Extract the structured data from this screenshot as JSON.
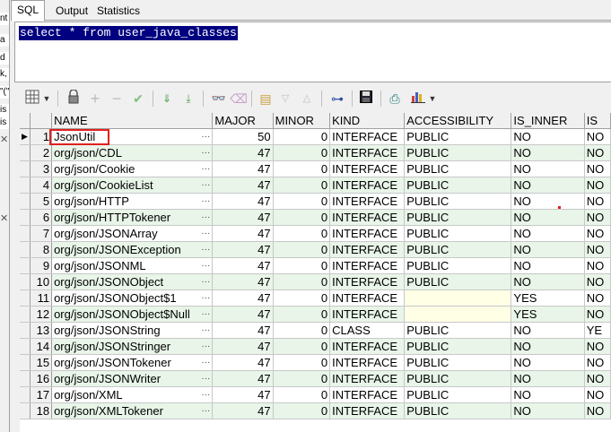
{
  "left_strip": {
    "fragments": [
      "nt",
      "a",
      "d",
      "k,",
      "\"(\"",
      "is",
      "is"
    ]
  },
  "tabs": [
    {
      "label": "SQL",
      "active": true
    },
    {
      "label": "Output",
      "active": false
    },
    {
      "label": "Statistics",
      "active": false
    }
  ],
  "editor": {
    "sql": "select * from user_java_classes"
  },
  "toolbar": {
    "icons": [
      "grid-options-icon",
      "dropdown-icon",
      "lock-icon",
      "add-record-icon",
      "delete-record-icon",
      "post-record-icon",
      "fetch-next-icon",
      "fetch-last-icon",
      "query-by-example-icon",
      "clear-icon",
      "export-icon",
      "sort-ascending-icon",
      "sort-descending-icon",
      "record-view-icon",
      "save-icon",
      "print-icon",
      "chart-icon"
    ]
  },
  "grid": {
    "columns": [
      "NAME",
      "MAJOR",
      "MINOR",
      "KIND",
      "ACCESSIBILITY",
      "IS_INNER",
      "IS"
    ],
    "rows": [
      [
        "1",
        "JsonUtil",
        "50",
        "0",
        "INTERFACE",
        "PUBLIC",
        "NO",
        "NO"
      ],
      [
        "2",
        "org/json/CDL",
        "47",
        "0",
        "INTERFACE",
        "PUBLIC",
        "NO",
        "NO"
      ],
      [
        "3",
        "org/json/Cookie",
        "47",
        "0",
        "INTERFACE",
        "PUBLIC",
        "NO",
        "NO"
      ],
      [
        "4",
        "org/json/CookieList",
        "47",
        "0",
        "INTERFACE",
        "PUBLIC",
        "NO",
        "NO"
      ],
      [
        "5",
        "org/json/HTTP",
        "47",
        "0",
        "INTERFACE",
        "PUBLIC",
        "NO",
        "NO"
      ],
      [
        "6",
        "org/json/HTTPTokener",
        "47",
        "0",
        "INTERFACE",
        "PUBLIC",
        "NO",
        "NO"
      ],
      [
        "7",
        "org/json/JSONArray",
        "47",
        "0",
        "INTERFACE",
        "PUBLIC",
        "NO",
        "NO"
      ],
      [
        "8",
        "org/json/JSONException",
        "47",
        "0",
        "INTERFACE",
        "PUBLIC",
        "NO",
        "NO"
      ],
      [
        "9",
        "org/json/JSONML",
        "47",
        "0",
        "INTERFACE",
        "PUBLIC",
        "NO",
        "NO"
      ],
      [
        "10",
        "org/json/JSONObject",
        "47",
        "0",
        "INTERFACE",
        "PUBLIC",
        "NO",
        "NO"
      ],
      [
        "11",
        "org/json/JSONObject$1",
        "47",
        "0",
        "INTERFACE",
        "",
        "YES",
        "NO"
      ],
      [
        "12",
        "org/json/JSONObject$Null",
        "47",
        "0",
        "INTERFACE",
        "",
        "YES",
        "NO"
      ],
      [
        "13",
        "org/json/JSONString",
        "47",
        "0",
        "CLASS",
        "PUBLIC",
        "NO",
        "YE"
      ],
      [
        "14",
        "org/json/JSONStringer",
        "47",
        "0",
        "INTERFACE",
        "PUBLIC",
        "NO",
        "NO"
      ],
      [
        "15",
        "org/json/JSONTokener",
        "47",
        "0",
        "INTERFACE",
        "PUBLIC",
        "NO",
        "NO"
      ],
      [
        "16",
        "org/json/JSONWriter",
        "47",
        "0",
        "INTERFACE",
        "PUBLIC",
        "NO",
        "NO"
      ],
      [
        "17",
        "org/json/XML",
        "47",
        "0",
        "INTERFACE",
        "PUBLIC",
        "NO",
        "NO"
      ],
      [
        "18",
        "org/json/XMLTokener",
        "47",
        "0",
        "INTERFACE",
        "PUBLIC",
        "NO",
        "NO"
      ]
    ],
    "current_row_indicator": "▶",
    "cell_ellipsis": "···"
  },
  "colors": {
    "selection_bg": "#000080",
    "even_row_bg": "#e8f5e8",
    "empty_cell_bg": "#ffffe6",
    "highlight_border": "#e02020"
  }
}
